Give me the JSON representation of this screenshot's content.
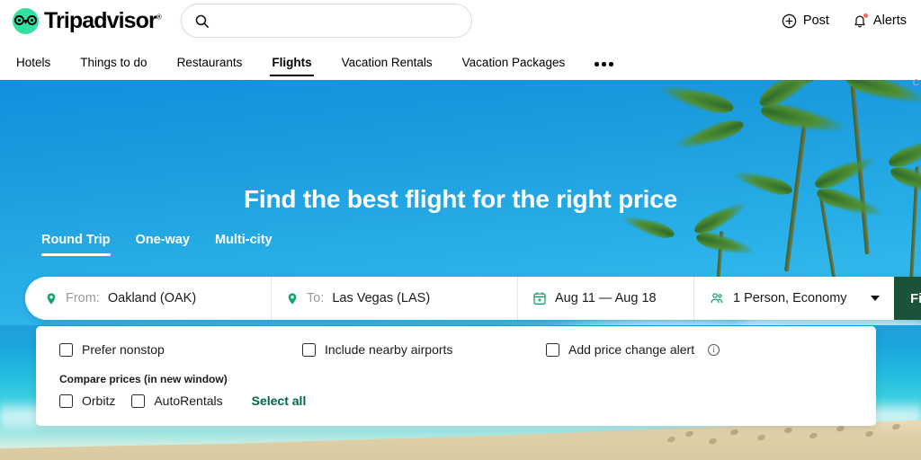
{
  "header": {
    "brand": "Tripadvisor",
    "brand_mark": "®",
    "logo_icon": "tripadvisor-owl-icon",
    "search": {
      "icon": "search-icon",
      "value": "",
      "placeholder": ""
    },
    "actions": [
      {
        "label": "Post",
        "icon": "plus-circle-icon"
      },
      {
        "label": "Alerts",
        "icon": "bell-icon",
        "has_badge": true
      }
    ],
    "nav": [
      {
        "label": "Hotels",
        "active": false
      },
      {
        "label": "Things to do",
        "active": false
      },
      {
        "label": "Restaurants",
        "active": false
      },
      {
        "label": "Flights",
        "active": true
      },
      {
        "label": "Vacation Rentals",
        "active": false
      },
      {
        "label": "Vacation Packages",
        "active": false
      }
    ],
    "more_icon": "ellipsis-icon",
    "clipped_text": "C"
  },
  "hero": {
    "headline": "Find the best flight for the right price",
    "trip_tabs": [
      {
        "label": "Round Trip",
        "active": true
      },
      {
        "label": "One-way",
        "active": false
      },
      {
        "label": "Multi-city",
        "active": false
      }
    ]
  },
  "search_form": {
    "from": {
      "label": "From:",
      "value": "Oakland (OAK)",
      "icon": "map-pin-icon"
    },
    "to": {
      "label": "To:",
      "value": "Las Vegas (LAS)",
      "icon": "map-pin-icon"
    },
    "dates": {
      "text": "Aug 11 — Aug 18",
      "icon": "calendar-icon"
    },
    "passengers": {
      "text": "1 Person, Economy",
      "icon": "people-icon",
      "chevron": "chevron-down-icon"
    },
    "submit": {
      "label": "Find flights"
    }
  },
  "options": {
    "checkboxes": [
      {
        "label": "Prefer nonstop",
        "checked": false
      },
      {
        "label": "Include nearby airports",
        "checked": false
      },
      {
        "label": "Add price change alert",
        "checked": false,
        "info_icon": "info-circle-icon"
      }
    ],
    "compare_title": "Compare prices (in new window)",
    "providers": [
      {
        "label": "Orbitz",
        "checked": false
      },
      {
        "label": "AutoRentals",
        "checked": false
      }
    ],
    "select_all": "Select all"
  },
  "colors": {
    "brand_green": "#34e0a1",
    "accent_green": "#00684a",
    "button_green": "#1a5336",
    "sky_blue": "#29b0e8",
    "badge_red": "#f2685f"
  }
}
